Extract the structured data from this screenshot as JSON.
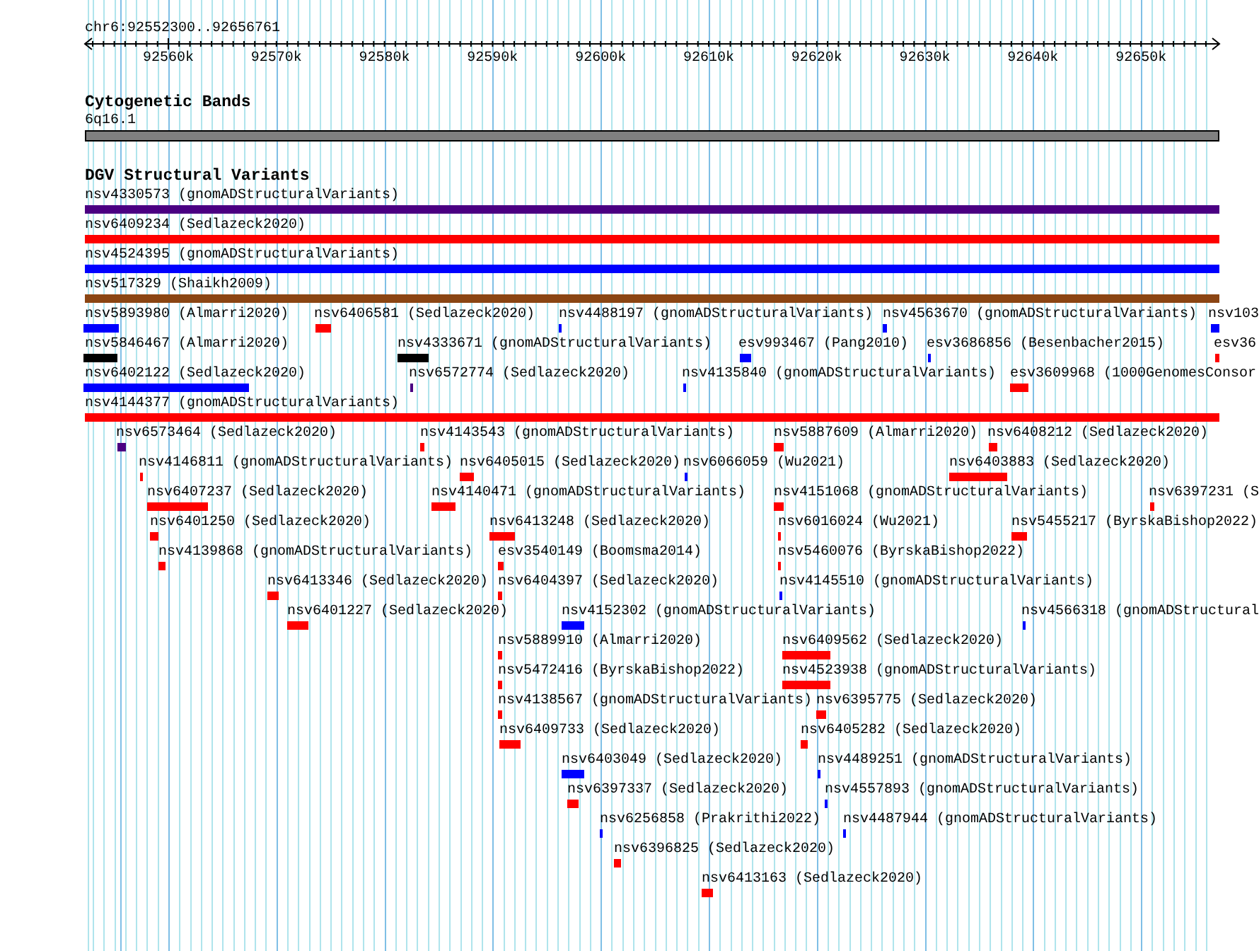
{
  "ruler": {
    "region": "chr6:92552300..92656761",
    "ticks": [
      "92560k",
      "92570k",
      "92580k",
      "92590k",
      "92600k",
      "92610k",
      "92620k",
      "92630k",
      "92640k",
      "92650k"
    ]
  },
  "cytobands": {
    "title": "Cytogenetic Bands",
    "band": {
      "label": "6q16.1",
      "color": "#808080"
    }
  },
  "variants": {
    "title": "DGV Structural Variants",
    "rows": [
      [
        {
          "label": "nsv4330573 (gnomADStructuralVariants)",
          "color": "#4b0082"
        }
      ],
      [
        {
          "label": "nsv6409234 (Sedlazeck2020)",
          "color": "#ff0000"
        }
      ],
      [
        {
          "label": "nsv4524395 (gnomADStructuralVariants)",
          "color": "#0000ff"
        }
      ],
      [
        {
          "label": "nsv517329 (Shaikh2009)",
          "color": "#8b4513"
        }
      ],
      [
        {
          "label": "nsv5893980 (Almarri2020)",
          "color": "#0000ff"
        },
        {
          "label": "nsv6406581 (Sedlazeck2020)",
          "color": "#ff0000"
        },
        {
          "label": "nsv4488197 (gnomADStructuralVariants)",
          "color": "#0000ff"
        },
        {
          "label": "nsv4563670 (gnomADStructuralVariants)",
          "color": "#0000ff"
        },
        {
          "label": "nsv103",
          "color": "#0000ff"
        }
      ],
      [
        {
          "label": "nsv5846467 (Almarri2020)",
          "color": "#000000"
        },
        {
          "label": "nsv4333671 (gnomADStructuralVariants)",
          "color": "#000000"
        },
        {
          "label": "esv993467 (Pang2010)",
          "color": "#0000ff"
        },
        {
          "label": "esv3686856 (Besenbacher2015)",
          "color": "#0000ff"
        },
        {
          "label": "esv36",
          "color": "#ff0000"
        }
      ],
      [
        {
          "label": "nsv6402122 (Sedlazeck2020)",
          "color": "#0000ff"
        },
        {
          "label": "nsv6572774 (Sedlazeck2020)",
          "color": "#4b0082"
        },
        {
          "label": "nsv4135840 (gnomADStructuralVariants)",
          "color": "#0000ff"
        },
        {
          "label": "esv3609968 (1000GenomesConsor",
          "color": "#ff0000"
        }
      ],
      [
        {
          "label": "nsv4144377 (gnomADStructuralVariants)",
          "color": "#ff0000"
        }
      ],
      [
        {
          "label": "nsv6573464 (Sedlazeck2020)",
          "color": "#4b0082"
        },
        {
          "label": "nsv4143543 (gnomADStructuralVariants)",
          "color": "#ff0000"
        },
        {
          "label": "nsv5887609 (Almarri2020)",
          "color": "#ff0000"
        },
        {
          "label": "nsv6408212 (Sedlazeck2020)",
          "color": "#ff0000"
        }
      ],
      [
        {
          "label": "nsv4146811 (gnomADStructuralVariants)",
          "color": "#ff0000"
        },
        {
          "label": "nsv6405015 (Sedlazeck2020)",
          "color": "#ff0000"
        },
        {
          "label": "nsv6066059 (Wu2021)",
          "color": "#0000ff"
        },
        {
          "label": "nsv6403883 (Sedlazeck2020)",
          "color": "#ff0000"
        }
      ],
      [
        {
          "label": "nsv6407237 (Sedlazeck2020)",
          "color": "#ff0000"
        },
        {
          "label": "nsv4140471 (gnomADStructuralVariants)",
          "color": "#ff0000"
        },
        {
          "label": "nsv4151068 (gnomADStructuralVariants)",
          "color": "#ff0000"
        },
        {
          "label": "nsv6397231 (S",
          "color": "#ff0000"
        }
      ],
      [
        {
          "label": "nsv6401250 (Sedlazeck2020)",
          "color": "#ff0000"
        },
        {
          "label": "nsv6413248 (Sedlazeck2020)",
          "color": "#ff0000"
        },
        {
          "label": "nsv6016024 (Wu2021)",
          "color": "#ff0000"
        },
        {
          "label": "nsv5455217 (ByrskaBishop2022)",
          "color": "#ff0000"
        }
      ],
      [
        {
          "label": "nsv4139868 (gnomADStructuralVariants)",
          "color": "#ff0000"
        },
        {
          "label": "esv3540149 (Boomsma2014)",
          "color": "#ff0000"
        },
        {
          "label": "nsv5460076 (ByrskaBishop2022)",
          "color": "#ff0000"
        }
      ],
      [
        {
          "label": "nsv6413346 (Sedlazeck2020)",
          "color": "#ff0000"
        },
        {
          "label": "nsv6404397 (Sedlazeck2020)",
          "color": "#ff0000"
        },
        {
          "label": "nsv4145510 (gnomADStructuralVariants)",
          "color": "#0000ff"
        }
      ],
      [
        {
          "label": "nsv6401227 (Sedlazeck2020)",
          "color": "#ff0000"
        },
        {
          "label": "nsv4152302 (gnomADStructuralVariants)",
          "color": "#0000ff"
        },
        {
          "label": "nsv4566318 (gnomADStructural",
          "color": "#0000ff"
        }
      ],
      [
        {
          "label": "nsv5889910 (Almarri2020)",
          "color": "#ff0000"
        },
        {
          "label": "nsv6409562 (Sedlazeck2020)",
          "color": "#ff0000"
        }
      ],
      [
        {
          "label": "nsv5472416 (ByrskaBishop2022)",
          "color": "#ff0000"
        },
        {
          "label": "nsv4523938 (gnomADStructuralVariants)",
          "color": "#ff0000"
        }
      ],
      [
        {
          "label": "nsv4138567 (gnomADStructuralVariants)",
          "color": "#ff0000"
        },
        {
          "label": "nsv6395775 (Sedlazeck2020)",
          "color": "#ff0000"
        }
      ],
      [
        {
          "label": "nsv6409733 (Sedlazeck2020)",
          "color": "#ff0000"
        },
        {
          "label": "nsv6405282 (Sedlazeck2020)",
          "color": "#ff0000"
        }
      ],
      [
        {
          "label": "nsv6403049 (Sedlazeck2020)",
          "color": "#0000ff"
        },
        {
          "label": "nsv4489251 (gnomADStructuralVariants)",
          "color": "#0000ff"
        }
      ],
      [
        {
          "label": "nsv6397337 (Sedlazeck2020)",
          "color": "#ff0000"
        },
        {
          "label": "nsv4557893 (gnomADStructuralVariants)",
          "color": "#0000ff"
        }
      ],
      [
        {
          "label": "nsv6256858 (Prakrithi2022)",
          "color": "#0000ff"
        },
        {
          "label": "nsv4487944 (gnomADStructuralVariants)",
          "color": "#0000ff"
        }
      ],
      [
        {
          "label": "nsv6396825 (Sedlazeck2020)",
          "color": "#ff0000"
        }
      ],
      [
        {
          "label": "nsv6413163 (Sedlazeck2020)",
          "color": "#ff0000"
        }
      ]
    ]
  }
}
